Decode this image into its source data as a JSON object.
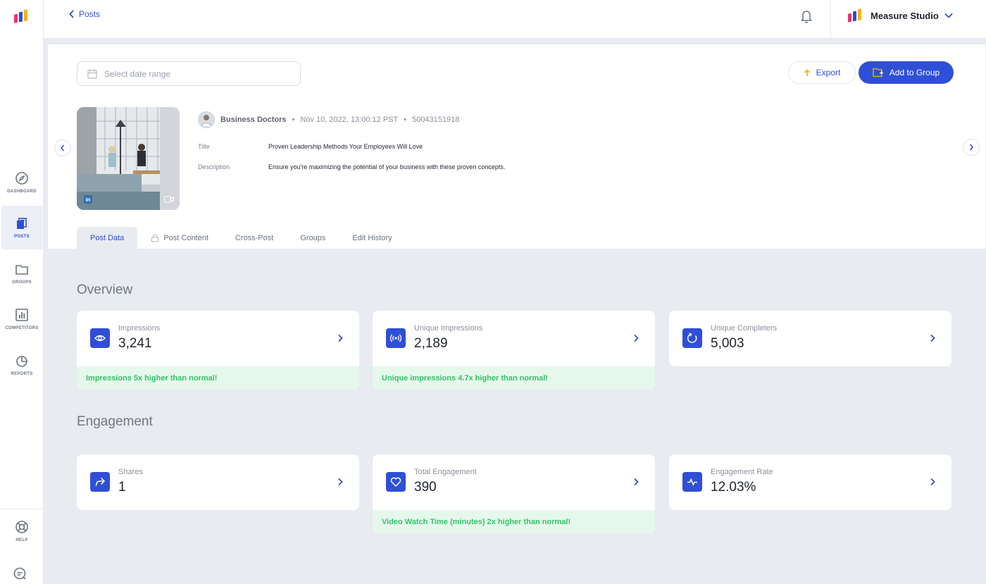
{
  "topbar": {
    "back_label": "Posts",
    "account_name": "Measure Studio"
  },
  "sidebar": {
    "items": [
      {
        "label": "DASHBOARD",
        "icon": "compass-icon"
      },
      {
        "label": "POSTS",
        "icon": "posts-icon",
        "active": true
      },
      {
        "label": "GROUPS",
        "icon": "folder-icon"
      },
      {
        "label": "COMPETITORS",
        "icon": "bar-chart-icon"
      },
      {
        "label": "REPORTS",
        "icon": "pie-chart-icon"
      },
      {
        "label": "HELP",
        "icon": "lifebuoy-icon"
      }
    ]
  },
  "toolbar": {
    "date_placeholder": "Select date range",
    "export_label": "Export",
    "add_group_label": "Add to Group"
  },
  "post": {
    "author": "Business Doctors",
    "date": "Nov 10, 2022, 13:00:12 PST",
    "id": "50043151918",
    "title_label": "Title",
    "title": "Proven Leadership Methods Your Employees Will Love",
    "description_label": "Description",
    "description": "Ensure you're maximizing the potential of your business with these proven concepts."
  },
  "tabs": [
    "Post Data",
    "Post Content",
    "Cross-Post",
    "Groups",
    "Edit History"
  ],
  "overview": {
    "title": "Overview",
    "cards": [
      {
        "label": "Impressions",
        "value": "3,241",
        "note": "Impressions 5x higher than normal!",
        "icon": "eye-icon"
      },
      {
        "label": "Unique Impressions",
        "value": "2,189",
        "note": "Unique impressions 4.7x higher than normal!",
        "icon": "broadcast-icon"
      },
      {
        "label": "Unique Completers",
        "value": "5,003",
        "note": "",
        "icon": "refresh-icon"
      }
    ]
  },
  "engagement": {
    "title": "Engagement",
    "cards": [
      {
        "label": "Shares",
        "value": "1",
        "note": "",
        "icon": "share-icon"
      },
      {
        "label": "Total Engagement",
        "value": "390",
        "note": "Video Watch Time (minutes) 2x higher than normal!",
        "icon": "heart-icon"
      },
      {
        "label": "Engagement Rate",
        "value": "12.03%",
        "note": "",
        "icon": "pulse-icon"
      }
    ]
  },
  "colors": {
    "accent": "#2f4fd6",
    "positive_text": "#34c26a",
    "positive_bg": "#e6f8ec",
    "page_bg": "#e8ebf0"
  }
}
